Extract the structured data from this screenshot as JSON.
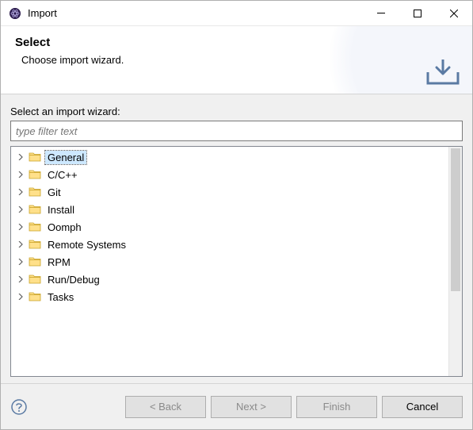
{
  "window": {
    "title": "Import"
  },
  "banner": {
    "heading": "Select",
    "subtitle": "Choose import wizard."
  },
  "content": {
    "label": "Select an import wizard:",
    "filter_placeholder": "type filter text"
  },
  "tree": {
    "items": [
      {
        "label": "General",
        "selected": true
      },
      {
        "label": "C/C++",
        "selected": false
      },
      {
        "label": "Git",
        "selected": false
      },
      {
        "label": "Install",
        "selected": false
      },
      {
        "label": "Oomph",
        "selected": false
      },
      {
        "label": "Remote Systems",
        "selected": false
      },
      {
        "label": "RPM",
        "selected": false
      },
      {
        "label": "Run/Debug",
        "selected": false
      },
      {
        "label": "Tasks",
        "selected": false
      }
    ]
  },
  "buttons": {
    "back": "< Back",
    "next": "Next >",
    "finish": "Finish",
    "cancel": "Cancel"
  }
}
